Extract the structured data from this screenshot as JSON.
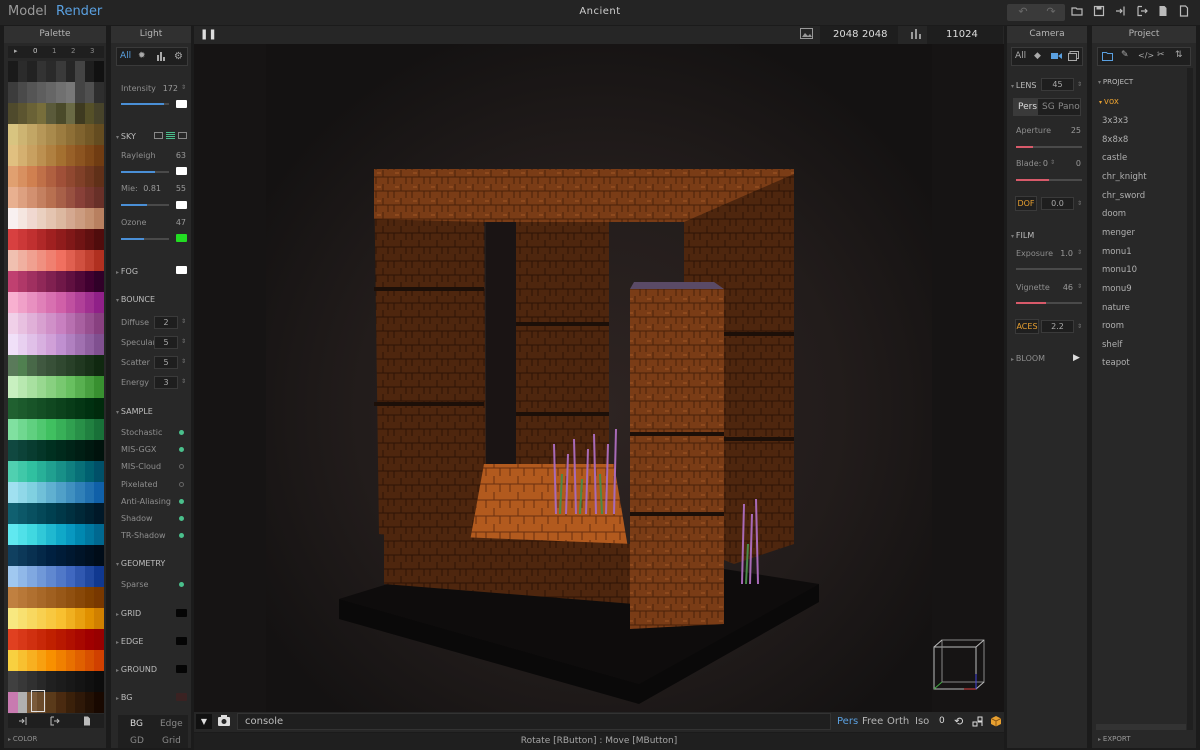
{
  "app": {
    "title": "Ancient",
    "tab_model": "Model",
    "tab_render": "Render"
  },
  "palette": {
    "header": "Palette",
    "pages": [
      "0",
      "1",
      "2",
      "3"
    ],
    "footer_label": "COLOR",
    "colors": [
      [
        "#1a1a1a",
        "#2b2b2b",
        "#222222",
        "#333333",
        "#2a2a2a",
        "#3a3a3a",
        "#262626",
        "#444444",
        "#1e1e1e",
        "#111111"
      ],
      [
        "#3c3c3c",
        "#4a4a4a",
        "#555555",
        "#5e5e5e",
        "#666666",
        "#707070",
        "#787878",
        "#444444",
        "#505050",
        "#2e2e2e"
      ],
      [
        "#4f4a2c",
        "#5c5530",
        "#6a6236",
        "#776e3b",
        "#5a5a3a",
        "#4a4a2a",
        "#6a6a45",
        "#3e3a20",
        "#555028",
        "#47432a"
      ],
      [
        "#d8c480",
        "#cdb472",
        "#c2a665",
        "#b69758",
        "#a98a4c",
        "#9c7c40",
        "#8e6f36",
        "#80632e",
        "#735826",
        "#644c20"
      ],
      [
        "#e0c080",
        "#d4b070",
        "#c8a060",
        "#bc9050",
        "#b08040",
        "#a47030",
        "#986028",
        "#8c5420",
        "#7f4818",
        "#703c12"
      ],
      [
        "#e0a070",
        "#d89060",
        "#d08050",
        "#c07048",
        "#b06040",
        "#a05038",
        "#904830",
        "#804028",
        "#703820",
        "#603018"
      ],
      [
        "#e8b090",
        "#dda080",
        "#d29070",
        "#c48060",
        "#b87050",
        "#a86048",
        "#985040",
        "#884038",
        "#783830",
        "#683028"
      ],
      [
        "#f8f0f0",
        "#f5e6e0",
        "#f0d8d0",
        "#ead0c0",
        "#e4c4b0",
        "#dcb8a0",
        "#d4a890",
        "#cc9c80",
        "#c49070",
        "#b88060"
      ],
      [
        "#d84040",
        "#cc3838",
        "#c03030",
        "#b02828",
        "#a02020",
        "#901c1c",
        "#801818",
        "#701414",
        "#601010",
        "#500c0c"
      ],
      [
        "#f0c0b0",
        "#f0b0a0",
        "#f0a090",
        "#f09080",
        "#f08070",
        "#f07060",
        "#e06050",
        "#d05040",
        "#c04030",
        "#b03020"
      ],
      [
        "#c04070",
        "#b03868",
        "#a03060",
        "#902858",
        "#802050",
        "#701848",
        "#601040",
        "#500838",
        "#400030",
        "#300028"
      ],
      [
        "#f8b0d0",
        "#f0a0c8",
        "#e890c0",
        "#e080b8",
        "#d870b0",
        "#d060a8",
        "#c050a0",
        "#b04098",
        "#a03090",
        "#902088"
      ],
      [
        "#f0d0e8",
        "#e8c0e0",
        "#e0b0d8",
        "#d8a0d0",
        "#d090c8",
        "#c880c0",
        "#b870b0",
        "#a860a0",
        "#985090",
        "#884080"
      ],
      [
        "#f0e0f8",
        "#e8d0f0",
        "#e0c0e8",
        "#d8b0e0",
        "#d0a0d8",
        "#c090d0",
        "#b080c0",
        "#a070b0",
        "#9060a0",
        "#805090"
      ],
      [
        "#5a7a5a",
        "#508050",
        "#486848",
        "#405840",
        "#385038",
        "#304830",
        "#284028",
        "#203820",
        "#183018",
        "#102810"
      ],
      [
        "#c8f0c0",
        "#b8e8b0",
        "#a8e0a0",
        "#98d890",
        "#88d080",
        "#78c870",
        "#68c060",
        "#58b050",
        "#48a040",
        "#389030"
      ],
      [
        "#206030",
        "#1c5a2c",
        "#185428",
        "#144e24",
        "#104820",
        "#0c421c",
        "#083c18",
        "#043614",
        "#003010",
        "#002a0c"
      ],
      [
        "#80e0a0",
        "#70d890",
        "#60d080",
        "#50c870",
        "#40c060",
        "#38b058",
        "#30a050",
        "#289048",
        "#208040",
        "#187038"
      ],
      [
        "#104840",
        "#0c4238",
        "#083c30",
        "#043628",
        "#003020",
        "#002a1c",
        "#002418",
        "#001e14",
        "#001810",
        "#00120c"
      ],
      [
        "#50d0b0",
        "#40c8a8",
        "#30c0a0",
        "#28b098",
        "#20a090",
        "#189088",
        "#108080",
        "#087078",
        "#006070",
        "#005068"
      ],
      [
        "#a0e0f0",
        "#90d8e8",
        "#80d0e0",
        "#70c0d8",
        "#60b0d0",
        "#50a0c8",
        "#4090c0",
        "#3080b8",
        "#2070b0",
        "#1060a8"
      ],
      [
        "#106070",
        "#0c5868",
        "#085060",
        "#044858",
        "#004050",
        "#003848",
        "#003040",
        "#002838",
        "#002030",
        "#001828"
      ],
      [
        "#60e8f0",
        "#50e0e8",
        "#40d8e0",
        "#30c8d8",
        "#20b8d0",
        "#10a8c8",
        "#0898c0",
        "#0088b0",
        "#0078a0",
        "#006890"
      ],
      [
        "#104060",
        "#0c3858",
        "#083050",
        "#042848",
        "#002040",
        "#001c38",
        "#001830",
        "#001428",
        "#001020",
        "#000c18"
      ],
      [
        "#a0c8f0",
        "#90b8e8",
        "#80a8e0",
        "#7098d8",
        "#6088d0",
        "#5078c8",
        "#4068c0",
        "#3058b0",
        "#2048a0",
        "#103890"
      ],
      [
        "#c08040",
        "#b87838",
        "#b07030",
        "#a86828",
        "#a06020",
        "#985818",
        "#905010",
        "#884808",
        "#804000",
        "#783800"
      ],
      [
        "#f8e880",
        "#f8e070",
        "#f8d860",
        "#f8d050",
        "#f8c840",
        "#f8c030",
        "#f0b020",
        "#e8a010",
        "#e09000",
        "#d08000"
      ],
      [
        "#e04020",
        "#d83818",
        "#d03010",
        "#c82808",
        "#c02000",
        "#b81800",
        "#b01000",
        "#a80800",
        "#a00000",
        "#980000"
      ],
      [
        "#f8d040",
        "#f8c030",
        "#f8b020",
        "#f8a010",
        "#f89000",
        "#f08000",
        "#e87000",
        "#e06000",
        "#d85000",
        "#d04000"
      ],
      [
        "#404040",
        "#383838",
        "#303030",
        "#282828",
        "#202020",
        "#1c1c1c",
        "#181818",
        "#141414",
        "#101010",
        "#0c0c0c"
      ],
      [
        "#c87ab0",
        "#b0b0b0",
        "#7a5a3a",
        "#6a4a2a",
        "#5a3a1a",
        "#4a2a10",
        "#3a200a",
        "#2e1808",
        "#221004",
        "#180800"
      ]
    ]
  },
  "light": {
    "header": "Light",
    "filter_all": "All",
    "intensity": {
      "label": "Intensity",
      "value": "172",
      "fraction": 0.9
    },
    "sky": {
      "label": "SKY",
      "rayleigh": {
        "label": "Rayleigh",
        "value": "63",
        "fraction": 0.7
      },
      "mie": {
        "label": "Mie:",
        "value1": "0.81",
        "value2": "55",
        "fraction": 0.55
      },
      "ozone": {
        "label": "Ozone",
        "value": "47",
        "fraction": 0.47
      }
    },
    "fog": {
      "label": "FOG"
    },
    "bounce": {
      "label": "BOUNCE",
      "items": [
        {
          "label": "Diffuse",
          "value": "2"
        },
        {
          "label": "Specular",
          "value": "5"
        },
        {
          "label": "Scatter",
          "value": "5"
        },
        {
          "label": "Energy",
          "value": "3"
        }
      ]
    },
    "sample": {
      "label": "SAMPLE",
      "items": [
        {
          "label": "Stochastic",
          "on": true
        },
        {
          "label": "MIS-GGX",
          "on": true
        },
        {
          "label": "MIS-Cloud",
          "on": false
        },
        {
          "label": "Pixelated",
          "on": false
        },
        {
          "label": "Anti-Aliasing",
          "on": true
        },
        {
          "label": "Shadow",
          "on": true
        },
        {
          "label": "TR-Shadow",
          "on": true
        }
      ]
    },
    "geometry": {
      "label": "GEOMETRY",
      "sparse": "Sparse"
    },
    "grid": "GRID",
    "edge": "EDGE",
    "ground": "GROUND",
    "bg": "BG",
    "bottom_tabs": [
      "BG",
      "Edge",
      "GD",
      "Grid"
    ]
  },
  "viewport": {
    "width": "2048",
    "height": "2048",
    "samples": "11024",
    "console_text": "console",
    "proj_modes": [
      "Pers",
      "Free",
      "Orth",
      "Iso"
    ],
    "counter": "0",
    "status": "Rotate [RButton] : Move [MButton]"
  },
  "camera": {
    "header": "Camera",
    "filter_all": "All",
    "lens": {
      "label": "LENS",
      "value": "45"
    },
    "lens_modes": [
      "Pers",
      "SG",
      "Pano"
    ],
    "aperture": {
      "label": "Aperture",
      "value": "25",
      "fraction": 0.25
    },
    "blade": {
      "label": "Blade:",
      "value1": "0",
      "value2": "0",
      "fraction": 0.5
    },
    "dof": {
      "label": "DOF",
      "value": "0.0"
    },
    "film": {
      "label": "FILM",
      "exposure": {
        "label": "Exposure",
        "value": "1.0"
      },
      "vignette": {
        "label": "Vignette",
        "value": "46",
        "fraction": 0.46
      },
      "aces": {
        "label": "ACES",
        "value": "2.2"
      }
    },
    "bloom": {
      "label": "BLOOM"
    }
  },
  "project": {
    "header": "Project",
    "section": "PROJECT",
    "folder": "vox",
    "files": [
      "3x3x3",
      "8x8x8",
      "castle",
      "chr_knight",
      "chr_sword",
      "doom",
      "menger",
      "monu1",
      "monu10",
      "monu9",
      "nature",
      "room",
      "shelf",
      "teapot"
    ],
    "export": "EXPORT"
  },
  "colors": {
    "accent": "#4a8fd6",
    "on_dot": "#4ac08c",
    "ozone": "#22dd22",
    "orange": "#e8a030",
    "red_slider": "#d85a6a"
  }
}
